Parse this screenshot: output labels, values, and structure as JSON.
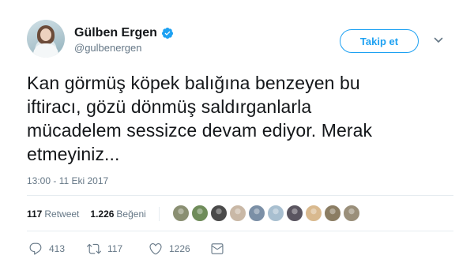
{
  "author": {
    "display_name": "Gülben Ergen",
    "handle": "@gulbenergen",
    "verified": true,
    "avatar_icon": "profile-photo"
  },
  "follow_button": {
    "label": "Takip et"
  },
  "tweet": {
    "lines": [
      "Kan görmüş köpek balığına benzeyen bu",
      "iftiracı, gözü dönmüş saldırganlarla",
      "mücadelem sessizce devam ediyor. Merak",
      "etmeyiniz..."
    ],
    "timestamp": "13:00 - 11 Eki 2017"
  },
  "stats": {
    "retweets_count": "117",
    "retweets_label": "Retweet",
    "likes_count": "1.226",
    "likes_label": "Beğeni"
  },
  "likers": [
    {
      "color": "#8a8f72"
    },
    {
      "color": "#6f8c5a"
    },
    {
      "color": "#4a4a4a"
    },
    {
      "color": "#c9b8a6"
    },
    {
      "color": "#7b8fa6"
    },
    {
      "color": "#a8bfd0"
    },
    {
      "color": "#5a5560"
    },
    {
      "color": "#d9b98e"
    },
    {
      "color": "#8b7d63"
    },
    {
      "color": "#9a8f7a"
    }
  ],
  "actions": {
    "reply_count": "413",
    "retweet_count": "117",
    "like_count": "1226"
  },
  "colors": {
    "accent": "#1da1f2",
    "text": "#14171a",
    "muted": "#657786",
    "divider": "#e6ecf0"
  }
}
